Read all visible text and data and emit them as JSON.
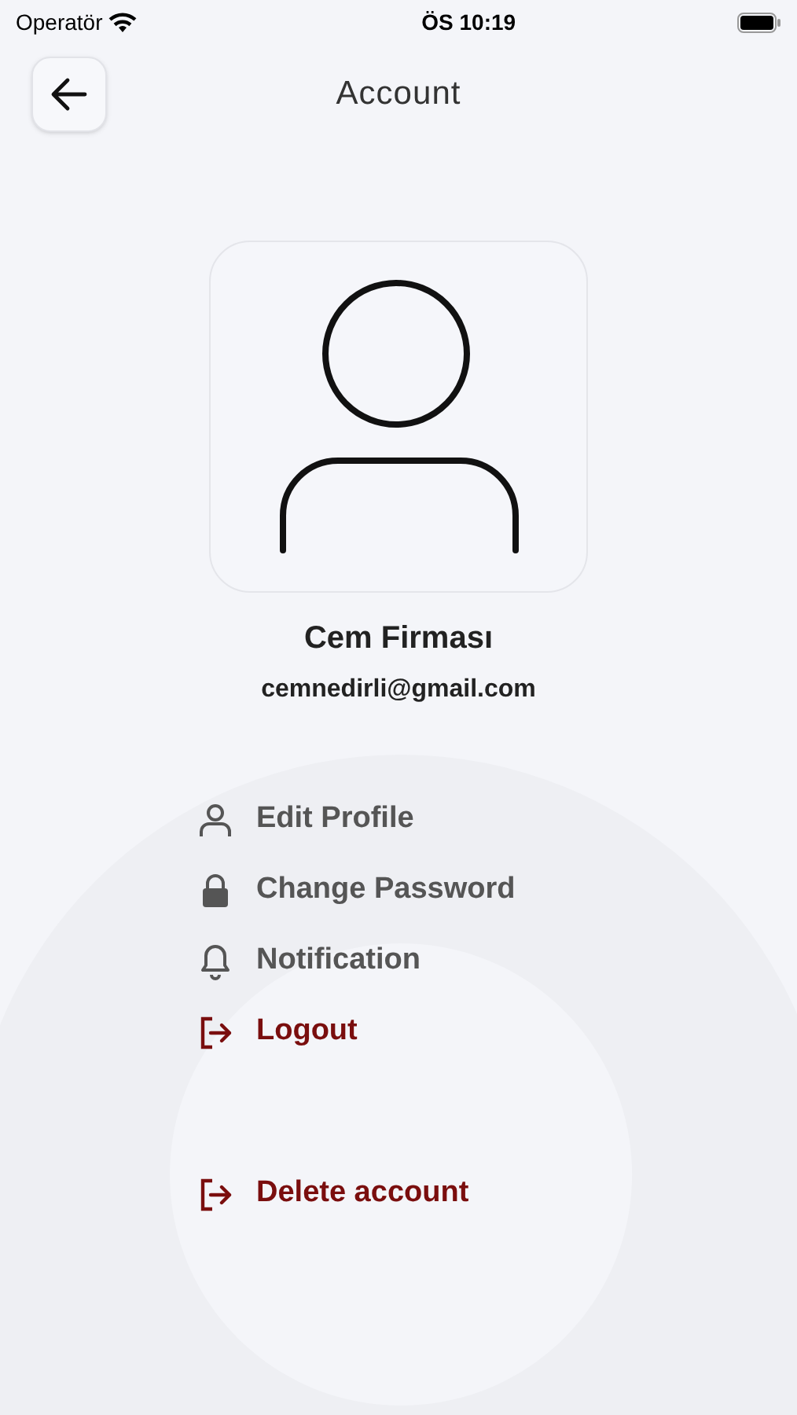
{
  "status_bar": {
    "carrier": "Operatör",
    "time": "ÖS 10:19"
  },
  "header": {
    "title": "Account"
  },
  "profile": {
    "name": "Cem Firması",
    "email": "cemnedirli@gmail.com"
  },
  "menu": [
    {
      "label": "Edit Profile",
      "kind": "person",
      "danger": false
    },
    {
      "label": "Change Password",
      "kind": "lock",
      "danger": false
    },
    {
      "label": "Notification",
      "kind": "bell",
      "danger": false
    },
    {
      "label": "Logout",
      "kind": "exit",
      "danger": true
    },
    {
      "label": "Delete account",
      "kind": "exit",
      "danger": true
    }
  ]
}
